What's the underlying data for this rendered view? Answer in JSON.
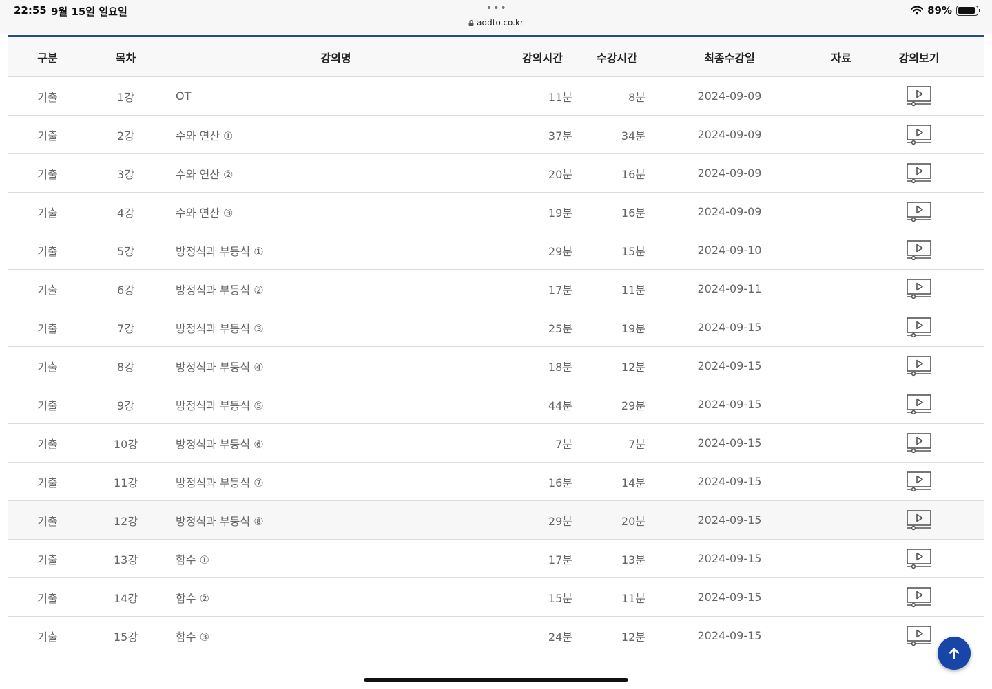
{
  "status_bar": {
    "time": "22:55",
    "date": "9월 15일 일요일",
    "dots": "•••",
    "url": "addto.co.kr",
    "battery": "89%",
    "battery_level": 0.89
  },
  "table": {
    "headers": {
      "category": "구분",
      "toc": "목차",
      "title": "강의명",
      "lecture_time": "강의시간",
      "watch_time": "수강시간",
      "last_date": "최종수강일",
      "materials": "자료",
      "view": "강의보기"
    },
    "rows": [
      {
        "category": "기출",
        "toc": "1강",
        "title": "OT",
        "lecture_time": "11분",
        "watch_time": "8분",
        "last_date": "2024-09-09"
      },
      {
        "category": "기출",
        "toc": "2강",
        "title": "수와 연산 ①",
        "lecture_time": "37분",
        "watch_time": "34분",
        "last_date": "2024-09-09"
      },
      {
        "category": "기출",
        "toc": "3강",
        "title": "수와 연산 ②",
        "lecture_time": "20분",
        "watch_time": "16분",
        "last_date": "2024-09-09"
      },
      {
        "category": "기출",
        "toc": "4강",
        "title": "수와 연산 ③",
        "lecture_time": "19분",
        "watch_time": "16분",
        "last_date": "2024-09-09"
      },
      {
        "category": "기출",
        "toc": "5강",
        "title": "방정식과 부등식 ①",
        "lecture_time": "29분",
        "watch_time": "15분",
        "last_date": "2024-09-10"
      },
      {
        "category": "기출",
        "toc": "6강",
        "title": "방정식과 부등식 ②",
        "lecture_time": "17분",
        "watch_time": "11분",
        "last_date": "2024-09-11"
      },
      {
        "category": "기출",
        "toc": "7강",
        "title": "방정식과 부등식 ③",
        "lecture_time": "25분",
        "watch_time": "19분",
        "last_date": "2024-09-15"
      },
      {
        "category": "기출",
        "toc": "8강",
        "title": "방정식과 부등식 ④",
        "lecture_time": "18분",
        "watch_time": "12분",
        "last_date": "2024-09-15"
      },
      {
        "category": "기출",
        "toc": "9강",
        "title": "방정식과 부등식 ⑤",
        "lecture_time": "44분",
        "watch_time": "29분",
        "last_date": "2024-09-15"
      },
      {
        "category": "기출",
        "toc": "10강",
        "title": "방정식과 부등식 ⑥",
        "lecture_time": "7분",
        "watch_time": "7분",
        "last_date": "2024-09-15"
      },
      {
        "category": "기출",
        "toc": "11강",
        "title": "방정식과 부등식 ⑦",
        "lecture_time": "16분",
        "watch_time": "14분",
        "last_date": "2024-09-15"
      },
      {
        "category": "기출",
        "toc": "12강",
        "title": "방정식과 부등식 ⑧",
        "lecture_time": "29분",
        "watch_time": "20분",
        "last_date": "2024-09-15"
      },
      {
        "category": "기출",
        "toc": "13강",
        "title": "함수 ①",
        "lecture_time": "17분",
        "watch_time": "13분",
        "last_date": "2024-09-15"
      },
      {
        "category": "기출",
        "toc": "14강",
        "title": "함수 ②",
        "lecture_time": "15분",
        "watch_time": "11분",
        "last_date": "2024-09-15"
      },
      {
        "category": "기출",
        "toc": "15강",
        "title": "함수 ③",
        "lecture_time": "24분",
        "watch_time": "12분",
        "last_date": "2024-09-15"
      }
    ]
  },
  "colors": {
    "accent": "#1f4e8c",
    "top_button": "#1746a8",
    "row_highlight": "#f7f7f7"
  },
  "icons": {
    "view": "play-monitor-icon",
    "top_button": "arrow-up-icon"
  }
}
